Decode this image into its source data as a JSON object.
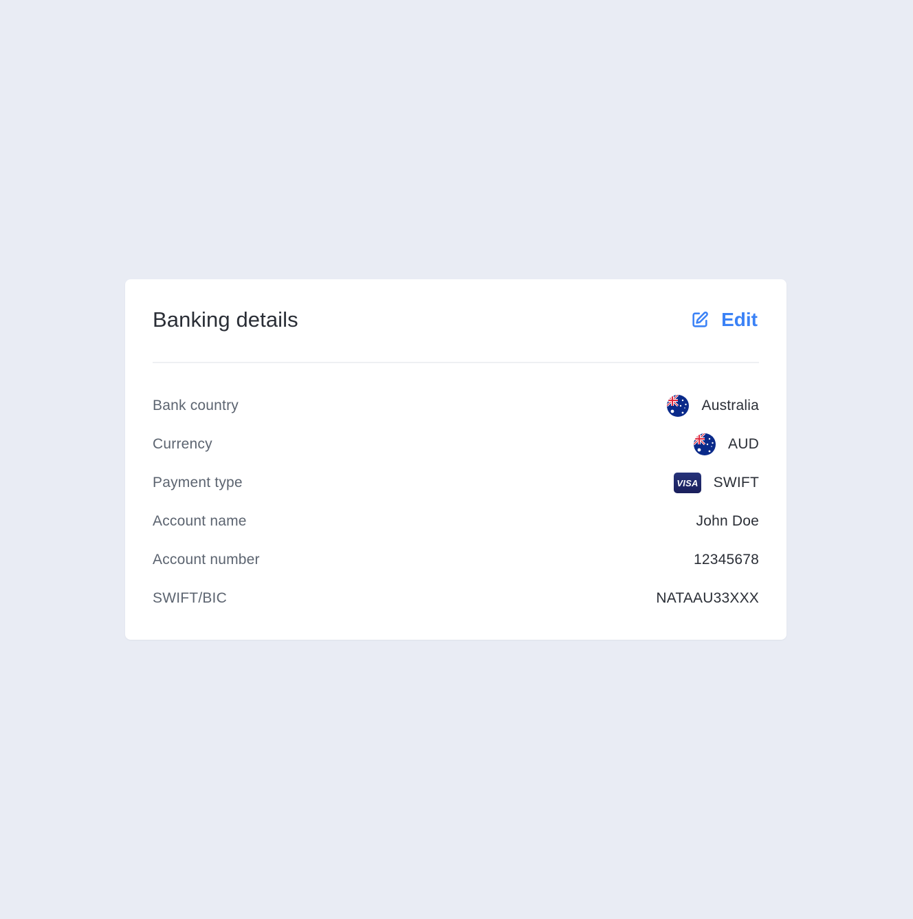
{
  "card": {
    "title": "Banking details",
    "edit_label": "Edit"
  },
  "details": [
    {
      "label": "Bank country",
      "value": "Australia",
      "icon": "australia-flag-icon"
    },
    {
      "label": "Currency",
      "value": "AUD",
      "icon": "australia-flag-icon"
    },
    {
      "label": "Payment type",
      "value": "SWIFT",
      "icon": "visa-icon"
    },
    {
      "label": "Account name",
      "value": "John Doe"
    },
    {
      "label": "Account number",
      "value": "12345678"
    },
    {
      "label": "SWIFT/BIC",
      "value": "NATAAU33XXX"
    }
  ],
  "colors": {
    "background": "#e9ecf4",
    "card": "#ffffff",
    "accent": "#3b82f6",
    "label_text": "#5c6470",
    "value_text": "#2a2e36",
    "divider": "#eef0f3"
  }
}
